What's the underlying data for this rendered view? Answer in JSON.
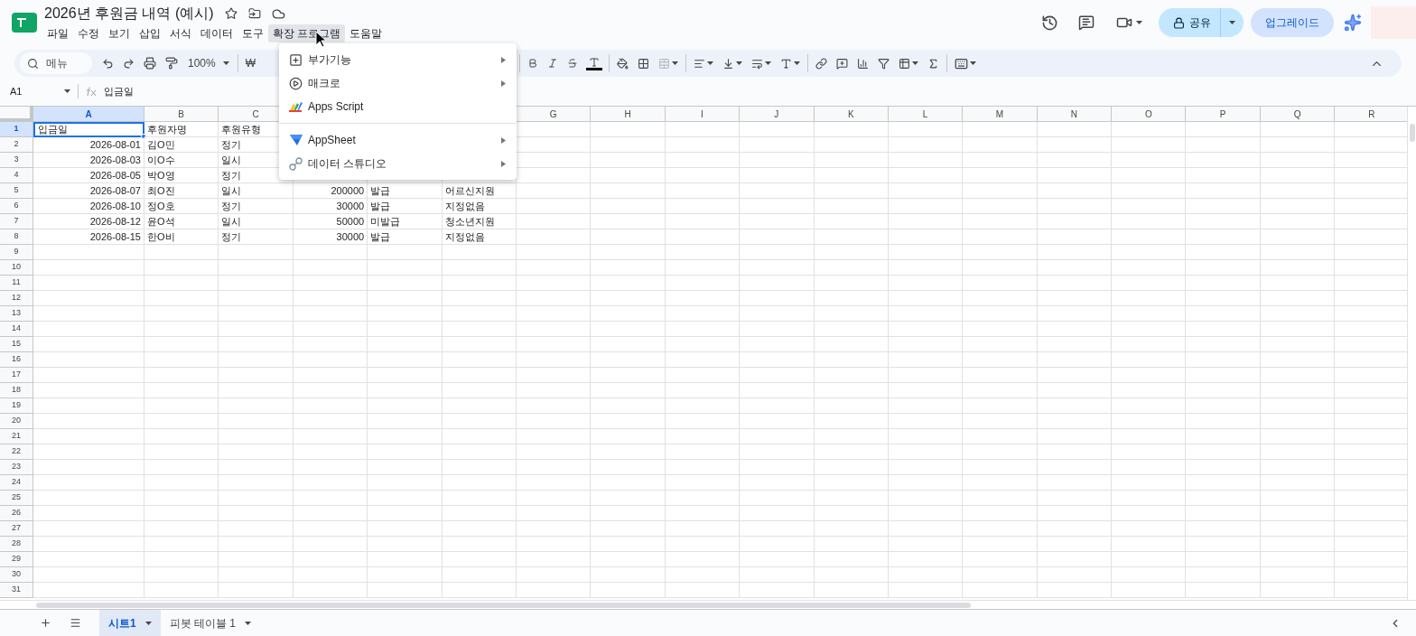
{
  "title": "2026년 후원금 내역 (예시)",
  "menus": [
    {
      "label": "파일",
      "selected": false
    },
    {
      "label": "수정",
      "selected": false
    },
    {
      "label": "보기",
      "selected": false
    },
    {
      "label": "삽입",
      "selected": false
    },
    {
      "label": "서식",
      "selected": false
    },
    {
      "label": "데이터",
      "selected": false
    },
    {
      "label": "도구",
      "selected": false
    },
    {
      "label": "확장 프로그램",
      "selected": true
    },
    {
      "label": "도움말",
      "selected": false
    }
  ],
  "share_button": "공유",
  "upgrade_button": "업그레이드",
  "toolbar": {
    "search_placeholder": "메뉴",
    "zoom": "100%",
    "currency": "₩"
  },
  "name_box": "A1",
  "formula": "입금일",
  "columns": [
    {
      "label": "A",
      "selected": true
    },
    {
      "label": "B",
      "selected": false
    },
    {
      "label": "C",
      "selected": false
    },
    {},
    {},
    {},
    {
      "label": "G",
      "selected": false
    },
    {
      "label": "H",
      "selected": false
    },
    {
      "label": "I",
      "selected": false
    },
    {
      "label": "J",
      "selected": false
    },
    {
      "label": "K",
      "selected": false
    },
    {
      "label": "L",
      "selected": false
    },
    {
      "label": "M",
      "selected": false
    },
    {
      "label": "N",
      "selected": false
    },
    {
      "label": "O",
      "selected": false
    },
    {
      "label": "P",
      "selected": false
    },
    {
      "label": "Q",
      "selected": false
    },
    {
      "label": "R",
      "selected": false
    }
  ],
  "rows": [
    {
      "label": "1",
      "selected": true,
      "cells": [
        {
          "text": "입금일",
          "kind": "text",
          "selected": true
        },
        {
          "text": "후원자명",
          "kind": "text",
          "selected": false
        },
        {
          "text": "후원유형",
          "kind": "text",
          "selected": false
        }
      ]
    },
    {
      "label": "2",
      "selected": false,
      "cells": [
        {
          "text": "2026-08-01",
          "kind": "number",
          "selected": false
        },
        {
          "text": "김O민",
          "kind": "text",
          "selected": false
        },
        {
          "text": "정기",
          "kind": "text",
          "selected": false
        }
      ]
    },
    {
      "label": "3",
      "selected": false,
      "cells": [
        {
          "text": "2026-08-03",
          "kind": "number",
          "selected": false
        },
        {
          "text": "이O수",
          "kind": "text",
          "selected": false
        },
        {
          "text": "일시",
          "kind": "text",
          "selected": false
        }
      ]
    },
    {
      "label": "4",
      "selected": false,
      "cells": [
        {
          "text": "2026-08-05",
          "kind": "number",
          "selected": false
        },
        {
          "text": "박O영",
          "kind": "text",
          "selected": false
        },
        {
          "text": "정기",
          "kind": "text",
          "selected": false
        }
      ]
    },
    {
      "label": "5",
      "selected": false,
      "cells": [
        {
          "text": "2026-08-07",
          "kind": "number",
          "selected": false
        },
        {
          "text": "최O진",
          "kind": "text",
          "selected": false
        },
        {
          "text": "일시",
          "kind": "text",
          "selected": false
        },
        {
          "text": "200000",
          "kind": "number",
          "selected": false
        },
        {
          "text": "발급",
          "kind": "text",
          "selected": false
        },
        {
          "text": "어르신지원",
          "kind": "text",
          "selected": false
        }
      ]
    },
    {
      "label": "6",
      "selected": false,
      "cells": [
        {
          "text": "2026-08-10",
          "kind": "number",
          "selected": false
        },
        {
          "text": "정O호",
          "kind": "text",
          "selected": false
        },
        {
          "text": "정기",
          "kind": "text",
          "selected": false
        },
        {
          "text": "30000",
          "kind": "number",
          "selected": false
        },
        {
          "text": "발급",
          "kind": "text",
          "selected": false
        },
        {
          "text": "지정없음",
          "kind": "text",
          "selected": false
        }
      ]
    },
    {
      "label": "7",
      "selected": false,
      "cells": [
        {
          "text": "2026-08-12",
          "kind": "number",
          "selected": false
        },
        {
          "text": "윤O석",
          "kind": "text",
          "selected": false
        },
        {
          "text": "일시",
          "kind": "text",
          "selected": false
        },
        {
          "text": "50000",
          "kind": "number",
          "selected": false
        },
        {
          "text": "미발급",
          "kind": "text",
          "selected": false
        },
        {
          "text": "청소년지원",
          "kind": "text",
          "selected": false
        }
      ]
    },
    {
      "label": "8",
      "selected": false,
      "cells": [
        {
          "text": "2026-08-15",
          "kind": "number",
          "selected": false
        },
        {
          "text": "한O비",
          "kind": "text",
          "selected": false
        },
        {
          "text": "정기",
          "kind": "text",
          "selected": false
        },
        {
          "text": "30000",
          "kind": "number",
          "selected": false
        },
        {
          "text": "발급",
          "kind": "text",
          "selected": false
        },
        {
          "text": "지정없음",
          "kind": "text",
          "selected": false
        }
      ]
    },
    {
      "label": "9",
      "selected": false
    },
    {
      "label": "10",
      "selected": false
    },
    {
      "label": "11",
      "selected": false
    },
    {
      "label": "12",
      "selected": false
    },
    {
      "label": "13",
      "selected": false
    },
    {
      "label": "14",
      "selected": false
    },
    {
      "label": "15",
      "selected": false
    },
    {
      "label": "16",
      "selected": false
    },
    {
      "label": "17",
      "selected": false
    },
    {
      "label": "18",
      "selected": false
    },
    {
      "label": "19",
      "selected": false
    },
    {
      "label": "20",
      "selected": false
    },
    {
      "label": "21",
      "selected": false
    },
    {
      "label": "22",
      "selected": false
    },
    {
      "label": "23",
      "selected": false
    },
    {
      "label": "24",
      "selected": false
    },
    {
      "label": "25",
      "selected": false
    },
    {
      "label": "26",
      "selected": false
    },
    {
      "label": "27",
      "selected": false
    },
    {
      "label": "28",
      "selected": false
    },
    {
      "label": "29",
      "selected": false
    },
    {
      "label": "30",
      "selected": false
    },
    {
      "label": "31",
      "selected": false
    }
  ],
  "dropdown": [
    {
      "kind": "addons",
      "label": "부가기능",
      "submenu": true
    },
    {
      "kind": "macro",
      "label": "매크로",
      "submenu": true
    },
    {
      "kind": "script",
      "label": "Apps Script",
      "submenu": false
    },
    {
      "kind": "divider"
    },
    {
      "kind": "appsheet",
      "label": "AppSheet",
      "submenu": true
    },
    {
      "kind": "studio",
      "label": "데이터 스튜디오",
      "submenu": true
    }
  ],
  "sheet_tabs": [
    {
      "label": "시트1",
      "selected": true
    },
    {
      "label": "피봇 테이블 1",
      "selected": false
    }
  ]
}
